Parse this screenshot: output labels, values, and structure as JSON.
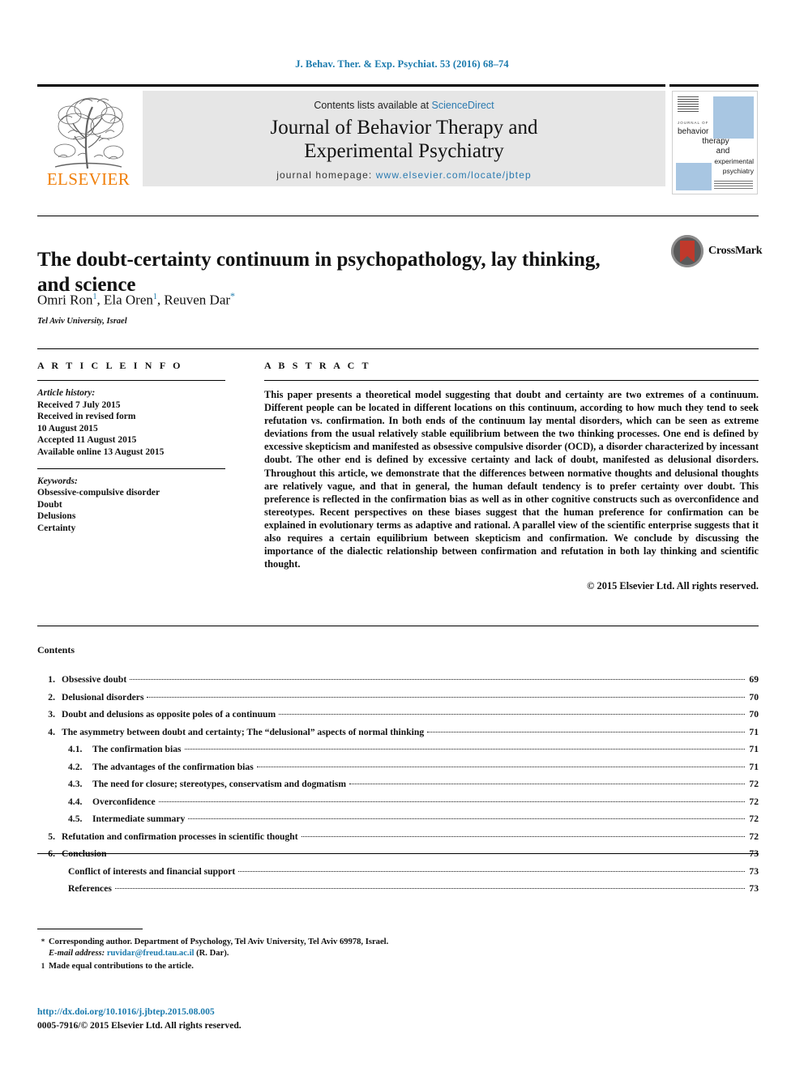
{
  "running_head": "J. Behav. Ther. & Exp. Psychiat. 53 (2016) 68–74",
  "masthead": {
    "publisher_wordmark": "ELSEVIER",
    "contents_prefix": "Contents lists available at",
    "contents_link": "ScienceDirect",
    "journal_line1": "Journal of Behavior Therapy and",
    "journal_line2": "Experimental Psychiatry",
    "homepage_prefix": "journal homepage:",
    "homepage_url": "www.elsevier.com/locate/jbtep",
    "cover": {
      "kicker": "JOURNAL OF",
      "line1": "behavior",
      "line2": "therapy",
      "line3": "and",
      "line4": "experimental",
      "line5": "psychiatry"
    }
  },
  "article": {
    "title": "The doubt-certainty continuum in psychopathology, lay thinking, and science",
    "authors": [
      {
        "name": "Omri Ron",
        "sup": "1"
      },
      {
        "name": "Ela Oren",
        "sup": "1"
      },
      {
        "name": "Reuven Dar",
        "sup": "*"
      }
    ],
    "affiliation": "Tel Aviv University, Israel",
    "crossmark_label": "CrossMark"
  },
  "info": {
    "heading": "A R T I C L E   I N F O",
    "history_label": "Article history:",
    "history": [
      "Received 7 July 2015",
      "Received in revised form",
      "10 August 2015",
      "Accepted 11 August 2015",
      "Available online 13 August 2015"
    ],
    "keywords_label": "Keywords:",
    "keywords": [
      "Obsessive-compulsive disorder",
      "Doubt",
      "Delusions",
      "Certainty"
    ]
  },
  "abstract": {
    "heading": "A B S T R A C T",
    "body": "This paper presents a theoretical model suggesting that doubt and certainty are two extremes of a continuum. Different people can be located in different locations on this continuum, according to how much they tend to seek refutation vs. confirmation. In both ends of the continuum lay mental disorders, which can be seen as extreme deviations from the usual relatively stable equilibrium between the two thinking processes. One end is defined by excessive skepticism and manifested as obsessive compulsive disorder (OCD), a disorder characterized by incessant doubt. The other end is defined by excessive certainty and lack of doubt, manifested as delusional disorders. Throughout this article, we demonstrate that the differences between normative thoughts and delusional thoughts are relatively vague, and that in general, the human default tendency is to prefer certainty over doubt. This preference is reflected in the confirmation bias as well as in other cognitive constructs such as overconfidence and stereotypes. Recent perspectives on these biases suggest that the human preference for confirmation can be explained in evolutionary terms as adaptive and rational. A parallel view of the scientific enterprise suggests that it also requires a certain equilibrium between skepticism and confirmation. We conclude by discussing the importance of the dialectic relationship between confirmation and refutation in both lay thinking and scientific thought.",
    "copyright": "© 2015 Elsevier Ltd. All rights reserved."
  },
  "contents": {
    "heading": "Contents",
    "entries": [
      {
        "num": "1.",
        "label": "Obsessive doubt",
        "page": "69",
        "level": "top"
      },
      {
        "num": "2.",
        "label": "Delusional disorders",
        "page": "70",
        "level": "top"
      },
      {
        "num": "3.",
        "label": "Doubt and delusions as opposite poles of a continuum",
        "page": "70",
        "level": "top"
      },
      {
        "num": "4.",
        "label": "The asymmetry between doubt and certainty; The “delusional” aspects of normal thinking",
        "page": "71",
        "level": "top"
      },
      {
        "num": "4.1.",
        "label": "The confirmation bias",
        "page": "71",
        "level": "sub"
      },
      {
        "num": "4.2.",
        "label": "The advantages of the confirmation bias",
        "page": "71",
        "level": "sub"
      },
      {
        "num": "4.3.",
        "label": "The need for closure; stereotypes, conservatism and dogmatism",
        "page": "72",
        "level": "sub"
      },
      {
        "num": "4.4.",
        "label": "Overconfidence",
        "page": "72",
        "level": "sub"
      },
      {
        "num": "4.5.",
        "label": "Intermediate summary",
        "page": "72",
        "level": "sub"
      },
      {
        "num": "5.",
        "label": "Refutation and confirmation processes in scientific thought",
        "page": "72",
        "level": "top"
      },
      {
        "num": "6.",
        "label": "Conclusion",
        "page": "73",
        "level": "top"
      },
      {
        "num": "",
        "label": "Conflict of interests and financial support",
        "page": "73",
        "level": "plain"
      },
      {
        "num": "",
        "label": "References",
        "page": "73",
        "level": "plain"
      }
    ]
  },
  "footnotes": {
    "corresponding_mark": "*",
    "corresponding_text": "Corresponding author. Department of Psychology, Tel Aviv University, Tel Aviv 69978, Israel.",
    "email_label": "E-mail address:",
    "email": "ruvidar@freud.tau.ac.il",
    "email_suffix": "(R. Dar).",
    "equal_mark": "1",
    "equal_text": "Made equal contributions to the article."
  },
  "imprint": {
    "doi": "http://dx.doi.org/10.1016/j.jbtep.2015.08.005",
    "issn_line": "0005-7916/© 2015 Elsevier Ltd. All rights reserved."
  },
  "colors": {
    "link_blue": "#1a7aad",
    "elsevier_orange": "#f07f09",
    "band_gray": "#e6e6e6",
    "cover_blue": "#a8c6e2",
    "crossmark_red": "#c0392b"
  }
}
